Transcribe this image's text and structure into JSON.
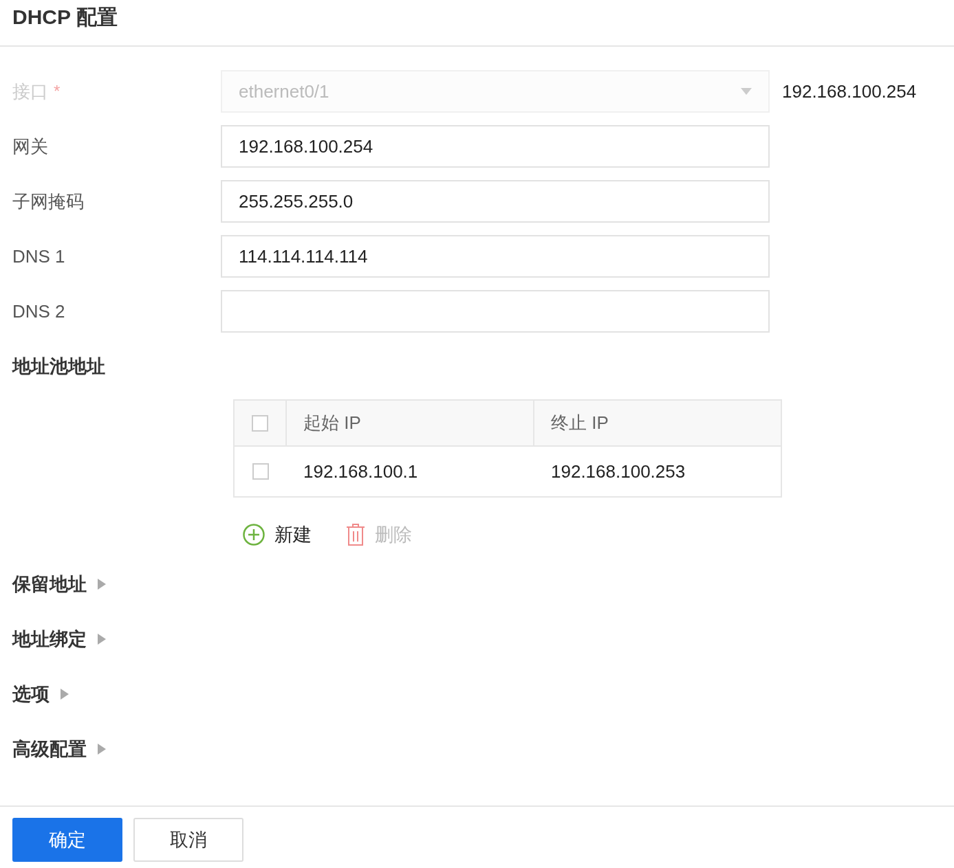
{
  "title": "DHCP 配置",
  "fields": [
    {
      "kind": "select",
      "label": "接口",
      "required_mark": "*",
      "disabled": true,
      "value": "ethernet0/1",
      "hint": "192.168.100.254"
    },
    {
      "kind": "text",
      "label": "网关",
      "disabled": false,
      "value": "192.168.100.254"
    },
    {
      "kind": "text",
      "label": "子网掩码",
      "disabled": false,
      "value": "255.255.255.0"
    },
    {
      "kind": "text",
      "label": "DNS 1",
      "disabled": false,
      "value": "114.114.114.114"
    },
    {
      "kind": "text",
      "label": "DNS 2",
      "disabled": false
    }
  ],
  "pool": {
    "heading": "地址池地址",
    "columns": [
      "起始 IP",
      "终止 IP"
    ],
    "header_checked": false,
    "rows": [
      {
        "checked": false,
        "cells": [
          "192.168.100.1",
          "192.168.100.253"
        ]
      }
    ],
    "actions": [
      {
        "kind": "add",
        "label": "新建",
        "disabled": false
      },
      {
        "kind": "delete",
        "label": "删除",
        "disabled": true
      }
    ]
  },
  "sections": [
    {
      "label": "保留地址",
      "expanded": false
    },
    {
      "label": "地址绑定",
      "expanded": false
    },
    {
      "label": "选项",
      "expanded": false
    },
    {
      "label": "高级配置",
      "expanded": false
    }
  ],
  "buttons": [
    {
      "label": "确定",
      "primary": true
    },
    {
      "label": "取消",
      "primary": false
    }
  ]
}
